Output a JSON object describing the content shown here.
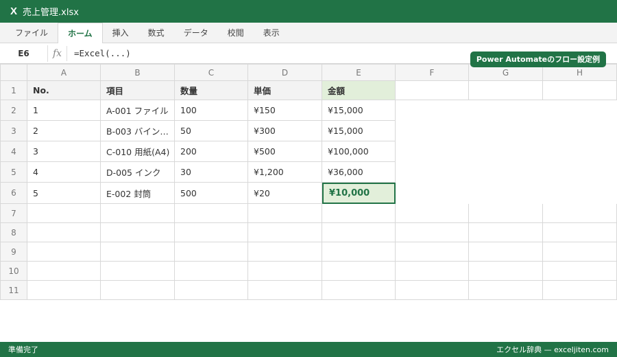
{
  "window": {
    "app_icon": "X",
    "title": "売上管理.xlsx"
  },
  "ribbon": {
    "tabs": [
      "ファイル",
      "ホーム",
      "挿入",
      "数式",
      "データ",
      "校閲",
      "表示"
    ],
    "active": 1
  },
  "formula_bar": {
    "name_box": "E6",
    "fx": "fx",
    "formula": "=Excel(...)"
  },
  "badge": "Power Automateのフロー設定例",
  "sheet": {
    "columns": [
      "A",
      "B",
      "C",
      "D",
      "E",
      "F",
      "G",
      "H"
    ],
    "row_numbers": [
      "1",
      "2",
      "3",
      "4",
      "5",
      "6",
      "7",
      "8",
      "9",
      "10",
      "11"
    ],
    "header_row": [
      "No.",
      "項目",
      "数量",
      "単価",
      "金額"
    ],
    "rows": [
      [
        "1",
        "A-001 ファイル",
        "100",
        "¥150",
        "¥15,000"
      ],
      [
        "2",
        "B-003 バイン…",
        "50",
        "¥300",
        "¥15,000"
      ],
      [
        "3",
        "C-010 用紙(A4)",
        "200",
        "¥500",
        "¥100,000"
      ],
      [
        "4",
        "D-005 インク",
        "30",
        "¥1,200",
        "¥36,000"
      ],
      [
        "5",
        "E-002 封筒",
        "500",
        "¥20",
        "¥10,000"
      ]
    ],
    "selected_cell": "E6"
  },
  "status": {
    "left": "準備完了",
    "right": "エクセル辞典 — exceljiten.com"
  },
  "colors": {
    "accent": "#217346",
    "selected_fill": "#e2efda"
  }
}
